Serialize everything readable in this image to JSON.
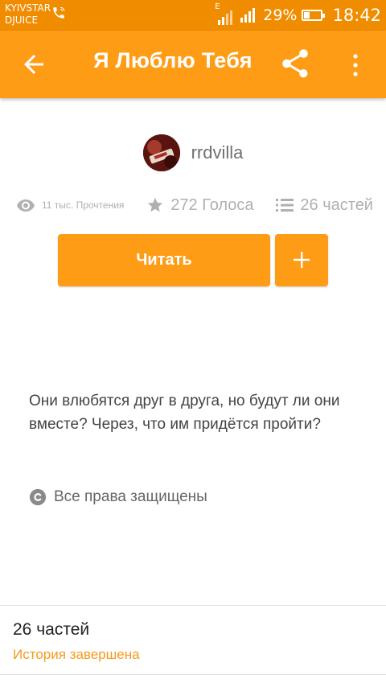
{
  "status_bar": {
    "carrier_line1": "KYIVSTAR",
    "carrier_line2": "DJUICE",
    "network": "E",
    "battery_percent": "29%",
    "time": "18:42",
    "battery_level": 0.29
  },
  "toolbar": {
    "title": "Я Люблю Тебя",
    "color": "#ff9c15"
  },
  "author": {
    "name": "rrdvilla"
  },
  "stats": {
    "reads": "11 тыс. Прочтения",
    "votes": "272 Голоса",
    "parts": "26 частей"
  },
  "actions": {
    "read_label": "Читать",
    "add_label": "+"
  },
  "description": "Они влюбятся друг в друга, но будут ли они вместе? Через, что им придётся пройти?",
  "copyright": "Все права защищены",
  "parts_section": {
    "title": "26 частей",
    "status": "История завершена"
  },
  "icons": {
    "back": "arrow-left-icon",
    "share": "share-icon",
    "more": "more-vertical-icon",
    "reads": "eye-icon",
    "votes": "star-icon",
    "parts": "list-icon",
    "copyright": "copyright-icon",
    "add": "plus-icon"
  }
}
